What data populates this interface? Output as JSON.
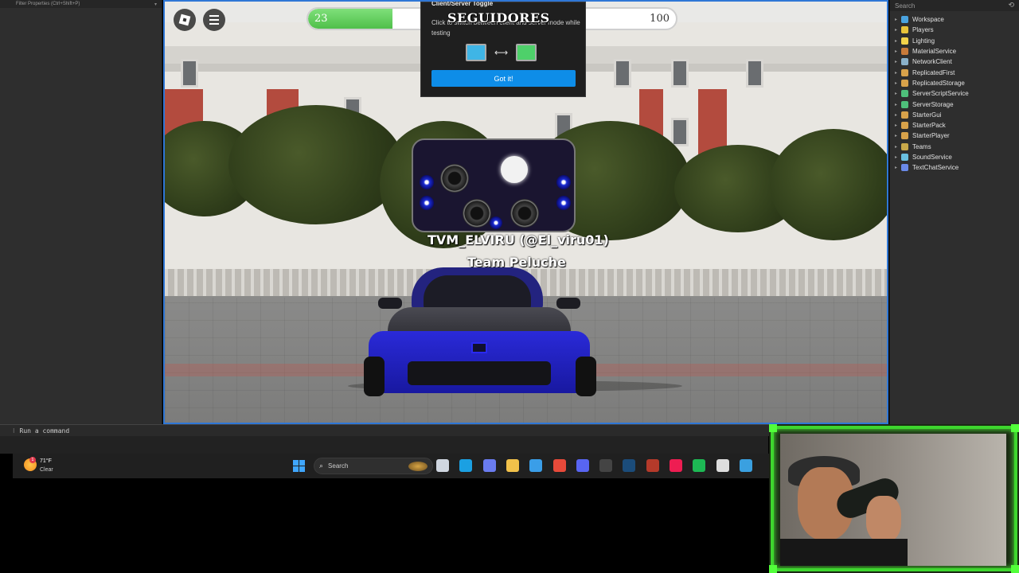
{
  "left_panel": {
    "filter_placeholder": "Filter Properties (Ctrl+Shift+P)"
  },
  "viewport": {
    "progress": {
      "current": "23",
      "goal": "100",
      "fraction": 0.23,
      "label": "SEGUIDORES"
    },
    "tooltip": {
      "title": "Client/Server Toggle",
      "body": "Click to switch between client and server mode while testing",
      "button": "Got it!"
    },
    "player": {
      "name": "TVM_ELVIRU (@El_viru01)",
      "team": "Team Peluche"
    }
  },
  "explorer": {
    "search_placeholder": "Search",
    "items": [
      {
        "label": "Workspace",
        "icon": "workspace-icon",
        "color": "#4aa3df"
      },
      {
        "label": "Players",
        "icon": "players-icon",
        "color": "#e8c33a"
      },
      {
        "label": "Lighting",
        "icon": "lighting-icon",
        "color": "#f2d24a"
      },
      {
        "label": "MaterialService",
        "icon": "material-icon",
        "color": "#c77a3a"
      },
      {
        "label": "NetworkClient",
        "icon": "network-icon",
        "color": "#8ab0c8"
      },
      {
        "label": "ReplicatedFirst",
        "icon": "replicated-first-icon",
        "color": "#d8a24a"
      },
      {
        "label": "ReplicatedStorage",
        "icon": "replicated-storage-icon",
        "color": "#d8a24a"
      },
      {
        "label": "ServerScriptService",
        "icon": "server-script-icon",
        "color": "#4ec07a"
      },
      {
        "label": "ServerStorage",
        "icon": "server-storage-icon",
        "color": "#4ec07a"
      },
      {
        "label": "StarterGui",
        "icon": "starter-gui-icon",
        "color": "#d8a24a"
      },
      {
        "label": "StarterPack",
        "icon": "starter-pack-icon",
        "color": "#d8a24a"
      },
      {
        "label": "StarterPlayer",
        "icon": "starter-player-icon",
        "color": "#d8a24a"
      },
      {
        "label": "Teams",
        "icon": "teams-icon",
        "color": "#c8a84a"
      },
      {
        "label": "SoundService",
        "icon": "sound-icon",
        "color": "#6ac0e0"
      },
      {
        "label": "TextChatService",
        "icon": "text-chat-icon",
        "color": "#6a8ae8"
      }
    ]
  },
  "command_bar": {
    "placeholder": "Run a command"
  },
  "taskbar": {
    "weather_temp": "71°F",
    "weather_desc": "Clear",
    "weather_badge": "1",
    "search_label": "Search",
    "apps": [
      {
        "name": "task-view-icon",
        "color": "#cfd6e0"
      },
      {
        "name": "edge-icon",
        "color": "#1ba0e2"
      },
      {
        "name": "copilot-icon",
        "color": "#6a7cf0"
      },
      {
        "name": "file-explorer-icon",
        "color": "#f2c14a"
      },
      {
        "name": "store-icon",
        "color": "#3a9ee8"
      },
      {
        "name": "chrome-icon",
        "color": "#e84a3a"
      },
      {
        "name": "discord-icon",
        "color": "#5865f2"
      },
      {
        "name": "obs-icon",
        "color": "#444444"
      },
      {
        "name": "steam-icon",
        "color": "#1b4c7a"
      },
      {
        "name": "tf-icon",
        "color": "#b53a2a"
      },
      {
        "name": "tiktok-icon",
        "color": "#ee1d52"
      },
      {
        "name": "spotify-icon",
        "color": "#1db954"
      },
      {
        "name": "roblox-studio-icon",
        "color": "#dddddd"
      },
      {
        "name": "notepad-icon",
        "color": "#3aa0e0"
      }
    ]
  }
}
